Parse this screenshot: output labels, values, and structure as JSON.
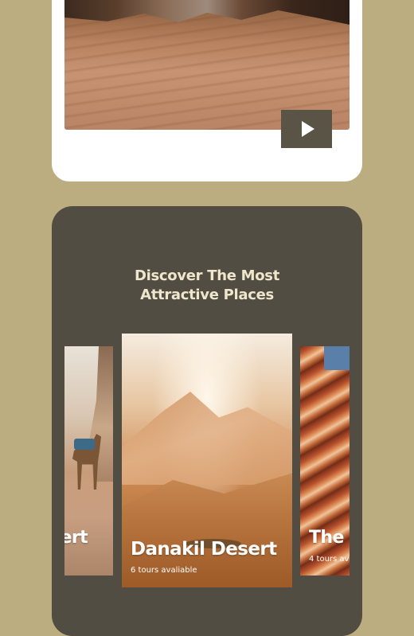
{
  "video": {
    "play_label": "Play video"
  },
  "discover": {
    "title_line1": "Discover The Most",
    "title_line2": "Attractive Places"
  },
  "slides": [
    {
      "name": "sert",
      "count": ""
    },
    {
      "name": "Danakil Desert",
      "count": "6 tours avaliable"
    },
    {
      "name": "The",
      "count": "4 tours av"
    }
  ],
  "colors": {
    "page_background": "#bbad80",
    "section_background": "#514d42",
    "title_color": "#efe6cc",
    "play_button": "#5a5446"
  },
  "icons": [
    "play-icon"
  ]
}
